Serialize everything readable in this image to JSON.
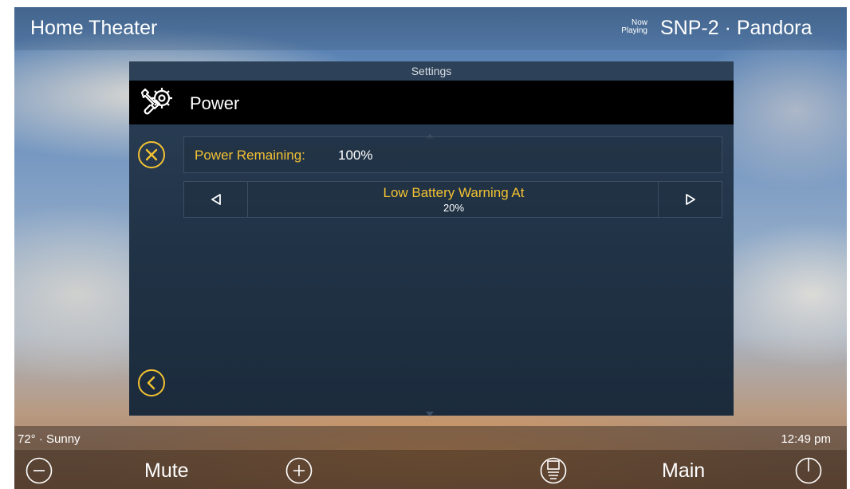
{
  "top_bar": {
    "app_title": "Home Theater",
    "now_playing_label": [
      "Now",
      "Playing"
    ],
    "source_title": "SNP-2 · Pandora"
  },
  "settings": {
    "header": "Settings",
    "section_title": "Power",
    "power_remaining_label": "Power Remaining:",
    "power_remaining_value": "100%",
    "low_battery_label": "Low Battery Warning At",
    "low_battery_value": "20%"
  },
  "status_bar": {
    "weather": "72° · Sunny",
    "time": "12:49 pm"
  },
  "bottom_bar": {
    "mute_label": "Mute",
    "main_label": "Main"
  },
  "colors": {
    "accent": "#f3c232",
    "panel": "#203245",
    "section_bar": "#000000"
  },
  "icons": [
    "wrench-gear-icon",
    "close-icon",
    "back-icon",
    "arrow-left-icon",
    "arrow-right-icon",
    "scroll-up-icon",
    "scroll-down-icon",
    "volume-down-icon",
    "volume-up-icon",
    "media-icon",
    "power-icon"
  ]
}
